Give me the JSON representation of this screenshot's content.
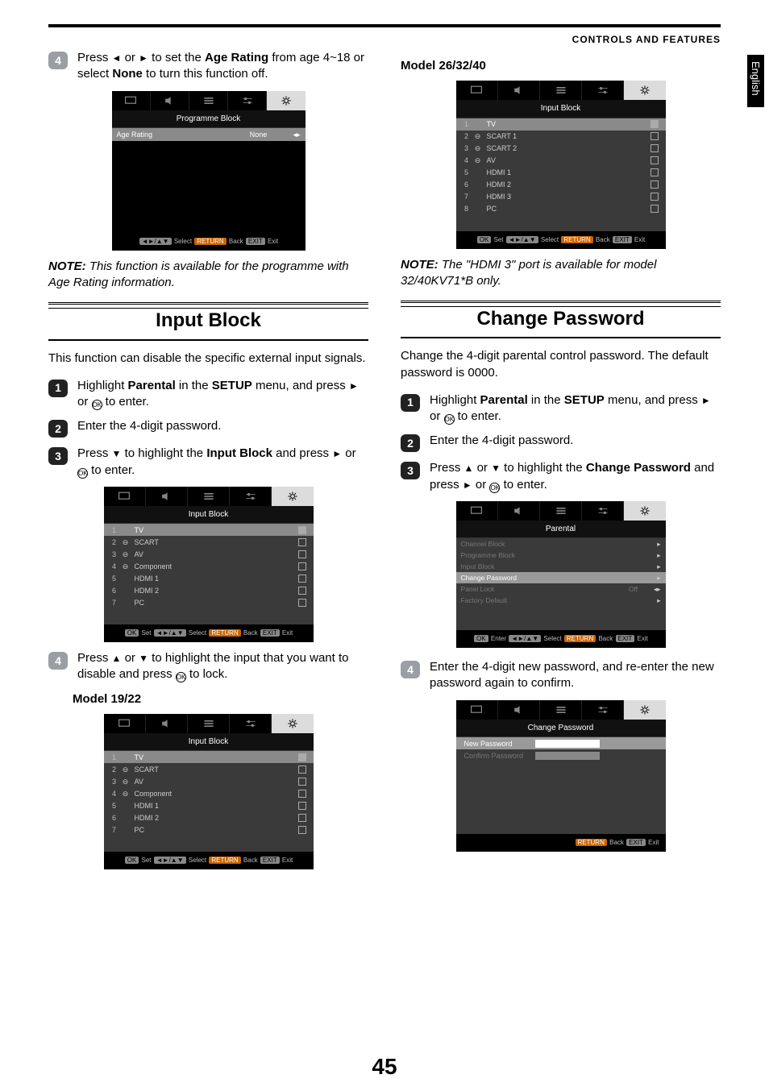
{
  "header": {
    "section": "CONTROLS AND FEATURES"
  },
  "side_tab": "English",
  "page_number": "45",
  "left": {
    "step4": {
      "num": "4",
      "text_pre": "Press ",
      "sym_left": "◄",
      "sym_or": " or ",
      "sym_right": "►",
      "text_mid": " to set the ",
      "bold1": "Age Rating",
      "text_after": " from age 4~18 or select ",
      "bold2": "None",
      "text_end": " to turn this function off."
    },
    "osd_prog": {
      "title": "Programme Block",
      "row_label": "Age Rating",
      "row_value": "None",
      "footer": {
        "select": "Select",
        "return": "RETURN",
        "back": "Back",
        "exit_btn": "EXIT",
        "exit": "Exit",
        "nav": "◄►/▲▼"
      }
    },
    "note1": {
      "prefix": "NOTE:",
      "text": " This function is available for the programme with Age Rating information."
    },
    "heading_input_block": "Input Block",
    "intro_input_block": "This function can disable the specific external input signals.",
    "steps_ib": {
      "s1": {
        "num": "1",
        "t1": "Highlight ",
        "b1": "Parental",
        "t2": " in the ",
        "b2": "SETUP",
        "t3": " menu, and press ",
        "sym": "►",
        "t4": " or ",
        "ok": "OK",
        "t5": " to enter."
      },
      "s2": {
        "num": "2",
        "text": "Enter the 4-digit password."
      },
      "s3": {
        "num": "3",
        "t1": "Press ",
        "sym1": "▼",
        "t2": " to highlight the ",
        "b1": "Input Block",
        "t3": " and press ",
        "sym2": "►",
        "t4": " or ",
        "ok": "OK",
        "t5": " to enter."
      }
    },
    "osd_ib": {
      "title": "Input Block",
      "rows": [
        {
          "n": "1",
          "icon": "",
          "label": "TV",
          "checked": true
        },
        {
          "n": "2",
          "icon": "⊖",
          "label": "SCART",
          "checked": false
        },
        {
          "n": "3",
          "icon": "⊖",
          "label": "AV",
          "checked": false
        },
        {
          "n": "4",
          "icon": "⊖",
          "label": "Component",
          "checked": false
        },
        {
          "n": "5",
          "icon": "",
          "label": "HDMI 1",
          "checked": false
        },
        {
          "n": "6",
          "icon": "",
          "label": "HDMI 2",
          "checked": false
        },
        {
          "n": "7",
          "icon": "",
          "label": "PC",
          "checked": false
        }
      ],
      "footer": {
        "ok": "OK",
        "set": "Set",
        "nav": "◄►/▲▼",
        "select": "Select",
        "return": "RETURN",
        "back": "Back",
        "exit_btn": "EXIT",
        "exit": "Exit"
      }
    },
    "step4b": {
      "num": "4",
      "t1": "Press ",
      "sym1": "▲",
      "or": " or ",
      "sym2": "▼",
      "t2": " to highlight the input that you want to disable and press  ",
      "ok": "OK",
      "t3": " to lock."
    },
    "model_label_1922": "Model 19/22",
    "osd_ib2": {
      "title": "Input Block",
      "rows": [
        {
          "n": "1",
          "icon": "",
          "label": "TV",
          "checked": true
        },
        {
          "n": "2",
          "icon": "⊖",
          "label": "SCART",
          "checked": false
        },
        {
          "n": "3",
          "icon": "⊖",
          "label": "AV",
          "checked": false
        },
        {
          "n": "4",
          "icon": "⊖",
          "label": "Component",
          "checked": false
        },
        {
          "n": "5",
          "icon": "",
          "label": "HDMI 1",
          "checked": false
        },
        {
          "n": "6",
          "icon": "",
          "label": "HDMI 2",
          "checked": false
        },
        {
          "n": "7",
          "icon": "",
          "label": "PC",
          "checked": false
        }
      ],
      "footer": {
        "ok": "OK",
        "set": "Set",
        "nav": "◄►/▲▼",
        "select": "Select",
        "return": "RETURN",
        "back": "Back",
        "exit_btn": "EXIT",
        "exit": "Exit"
      }
    }
  },
  "right": {
    "model_label_263240": "Model 26/32/40",
    "osd_ib3": {
      "title": "Input Block",
      "rows": [
        {
          "n": "1",
          "icon": "",
          "label": "TV",
          "checked": true
        },
        {
          "n": "2",
          "icon": "⊖",
          "label": "SCART 1",
          "checked": false
        },
        {
          "n": "3",
          "icon": "⊖",
          "label": "SCART 2",
          "checked": false
        },
        {
          "n": "4",
          "icon": "⊖",
          "label": "AV",
          "checked": false
        },
        {
          "n": "5",
          "icon": "",
          "label": "HDMI 1",
          "checked": false
        },
        {
          "n": "6",
          "icon": "",
          "label": "HDMI 2",
          "checked": false
        },
        {
          "n": "7",
          "icon": "",
          "label": "HDMI 3",
          "checked": false
        },
        {
          "n": "8",
          "icon": "",
          "label": "PC",
          "checked": false
        }
      ],
      "footer": {
        "ok": "OK",
        "set": "Set",
        "nav": "◄►/▲▼",
        "select": "Select",
        "return": "RETURN",
        "back": "Back",
        "exit_btn": "EXIT",
        "exit": "Exit"
      }
    },
    "note2": {
      "prefix": "NOTE:",
      "text": " The \"HDMI 3\" port is available for model 32/40KV71*B only."
    },
    "heading_change_pw": "Change Password",
    "intro_change_pw": "Change the 4-digit parental control password. The default password is 0000.",
    "steps_cp": {
      "s1": {
        "num": "1",
        "t1": "Highlight ",
        "b1": "Parental",
        "t2": " in the ",
        "b2": "SETUP",
        "t3": " menu, and press ",
        "sym": "►",
        "t4": " or ",
        "ok": "OK",
        "t5": " to enter."
      },
      "s2": {
        "num": "2",
        "text": "Enter the 4-digit password."
      },
      "s3": {
        "num": "3",
        "t1": "Press ",
        "sym1": "▲",
        "or": " or ",
        "sym2": "▼",
        "t2": " to highlight the ",
        "b1": "Change Password",
        "t3": " and press ",
        "sym3": "►",
        "t4": " or ",
        "ok": "OK",
        "t5": " to enter."
      }
    },
    "osd_parental": {
      "title": "Parental",
      "rows": [
        {
          "label": "Channel Block",
          "val": "",
          "active": false
        },
        {
          "label": "Programme Block",
          "val": "",
          "active": false
        },
        {
          "label": "Input Block",
          "val": "",
          "active": false
        },
        {
          "label": "Change Password",
          "val": "",
          "active": true
        },
        {
          "label": "Panel Lock",
          "val": "Off",
          "active": false
        },
        {
          "label": "Factory Default",
          "val": "",
          "active": false
        }
      ],
      "footer": {
        "ok": "OK",
        "enter": "Enter",
        "nav": "◄►/▲▼",
        "select": "Select",
        "return": "RETURN",
        "back": "Back",
        "exit_btn": "EXIT",
        "exit": "Exit"
      }
    },
    "step4c": {
      "num": "4",
      "text": "Enter the 4-digit new password, and re-enter the new password again to confirm."
    },
    "osd_changepw": {
      "title": "Change Password",
      "row1": "New Password",
      "row2": "Confirm Password",
      "footer": {
        "return": "RETURN",
        "back": "Back",
        "exit_btn": "EXIT",
        "exit": "Exit"
      }
    }
  },
  "icons": {
    "tab1": "screen-icon",
    "tab2": "speaker-icon",
    "tab3": "list-icon",
    "tab4": "sliders-icon",
    "tab5": "gear-icon"
  }
}
